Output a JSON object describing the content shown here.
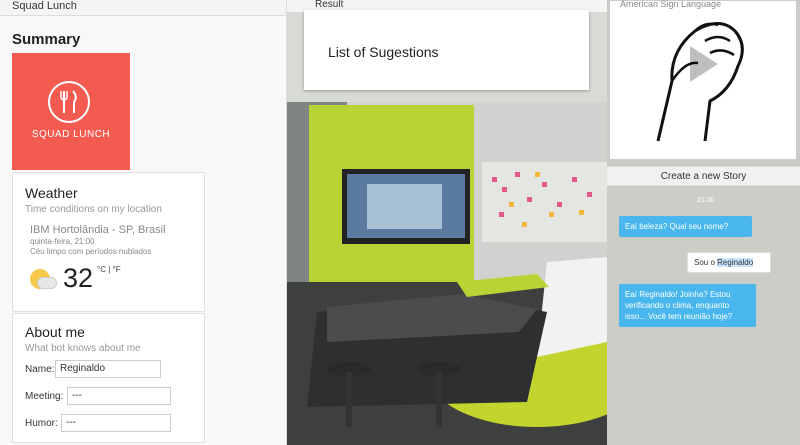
{
  "left_panel": {
    "header": "Squad Lunch",
    "summary_title": "Summary",
    "logo_text": "SQUAD LUNCH",
    "weather": {
      "title": "Weather",
      "subtitle": "Time conditions on my location",
      "location": "IBM Hortolândia - SP, Brasil",
      "datetime": "quinta-feira, 21:00",
      "conditions": "Céu limpo com períodos nublados",
      "temperature": "32",
      "unit_c": "°C",
      "unit_sep": "|",
      "unit_f": "°F",
      "icon": "partly-cloudy-icon"
    },
    "about": {
      "title": "About me",
      "subtitle": "What bot knows about me",
      "name_label": "Name:",
      "name_value": "Reginaldo",
      "meeting_label": "Meeting:",
      "meeting_value": "---",
      "humor_label": "Humor:",
      "humor_value": "---"
    }
  },
  "middle_panel": {
    "header": "Result",
    "suggestions_title": "List of Sugestions"
  },
  "right_panel": {
    "asl_title": "American Sign Language",
    "create_story": "Create a new Story",
    "timestamp": "21:00",
    "messages": [
      {
        "from": "bot",
        "text": "Eaí beleza? Qual seu nome?"
      },
      {
        "from": "user",
        "text_prefix": "Sou o ",
        "text_highlight": "Reginaldo"
      },
      {
        "from": "bot",
        "text": "Eaí Reginaldo! Joinha? Estou verificando o clima, enquanto isso... Você tem reunião hoje?"
      }
    ]
  },
  "colors": {
    "logo_bg": "#f45b50",
    "bot_bubble": "#49b7ed",
    "lime_wall": "#b8d434"
  }
}
